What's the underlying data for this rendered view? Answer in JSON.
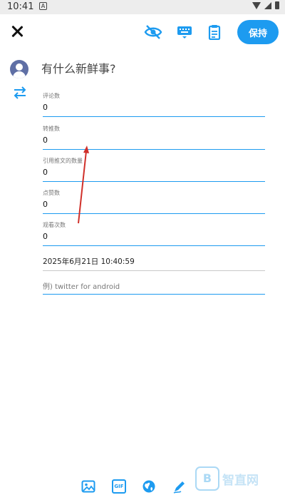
{
  "status_bar": {
    "time": "10:41",
    "notification_glyph": "A"
  },
  "toolbar": {
    "close_icon": "close-icon",
    "visibility_icon": "eye-off-icon",
    "keyboard_icon": "keyboard-icon",
    "clipboard_icon": "clipboard-icon",
    "save_label": "保持"
  },
  "compose": {
    "prompt": "有什么新鲜事?",
    "avatar_icon": "avatar-icon",
    "swap_icon": "swap-arrows-icon"
  },
  "fields": [
    {
      "label": "评论数",
      "value": "0"
    },
    {
      "label": "转推数",
      "value": "0"
    },
    {
      "label": "引用推文的数量",
      "value": "0"
    },
    {
      "label": "点赞数",
      "value": "0"
    },
    {
      "label": "观看次数",
      "value": "0"
    }
  ],
  "datetime": "2025年6月21日 10:40:59",
  "via_placeholder": "例) twitter for android",
  "bottom_bar": {
    "image_icon": "image-icon",
    "gif_label": "GIF",
    "globe_icon": "globe-icon",
    "pen_icon": "pen-icon"
  },
  "watermark": {
    "logo_glyph": "B",
    "text": "智直网"
  },
  "colors": {
    "accent": "#1d9bf0",
    "annotation_arrow": "#d0302a"
  }
}
